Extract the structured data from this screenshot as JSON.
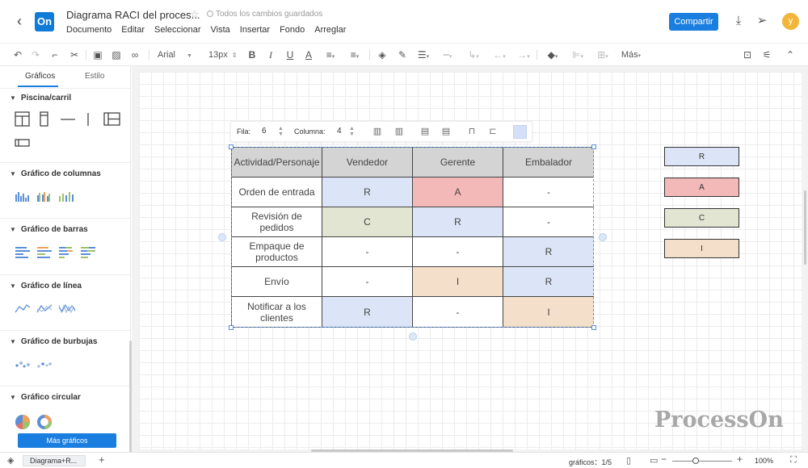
{
  "header": {
    "logo": "On",
    "title": "Diagrama RACI del proces...",
    "save_status": "Todos los cambios guardados",
    "menu": [
      "Documento",
      "Editar",
      "Seleccionar",
      "Vista",
      "Insertar",
      "Fondo",
      "Arreglar"
    ],
    "share_label": "Compartir",
    "avatar_initial": "y",
    "avatar_color": "#f2b53a",
    "accent_color": "#1a7ee0"
  },
  "toolbar": {
    "font_family": "Arial",
    "font_size": "13px",
    "more_label": "Más"
  },
  "left_panel": {
    "tabs": [
      "Gráficos",
      "Estilo"
    ],
    "sections": [
      {
        "title": "Piscina/carril"
      },
      {
        "title": "Gráfico de columnas"
      },
      {
        "title": "Gráfico de barras"
      },
      {
        "title": "Gráfico de línea"
      },
      {
        "title": "Gráfico de burbujas"
      },
      {
        "title": "Gráfico circular"
      }
    ],
    "more_button": "Más gráficos"
  },
  "table_toolbar": {
    "row_label": "Fila:",
    "row_value": "6",
    "col_label": "Columna:",
    "col_value": "4"
  },
  "raci_table": {
    "headers": [
      "Actividad/Personaje",
      "Vendedor",
      "Gerente",
      "Embalador"
    ],
    "rows": [
      [
        "Orden de entrada",
        "R",
        "A",
        "-"
      ],
      [
        "Revisión de pedidos",
        "C",
        "R",
        "-"
      ],
      [
        "Empaque de productos",
        "-",
        "-",
        "R"
      ],
      [
        "Envío",
        "-",
        "I",
        "R"
      ],
      [
        "Notificar a los clientes",
        "R",
        "-",
        "I"
      ]
    ],
    "colors": {
      "header": "#d4d4d4",
      "R": "#dce5f7",
      "A": "#f3b8b8",
      "C": "#e3e5d3",
      "I": "#f3dfca",
      "none": "#ffffff"
    }
  },
  "legend": [
    {
      "label": "R",
      "color": "#dce5f7"
    },
    {
      "label": "A",
      "color": "#f3b8b8"
    },
    {
      "label": "C",
      "color": "#e3e5d3"
    },
    {
      "label": "I",
      "color": "#f3dfca"
    }
  ],
  "watermark": "ProcessOn",
  "bottom_bar": {
    "page_tab": "Diagrama+R...",
    "shapes_count": "gráficos：1/5",
    "zoom": "100%"
  }
}
